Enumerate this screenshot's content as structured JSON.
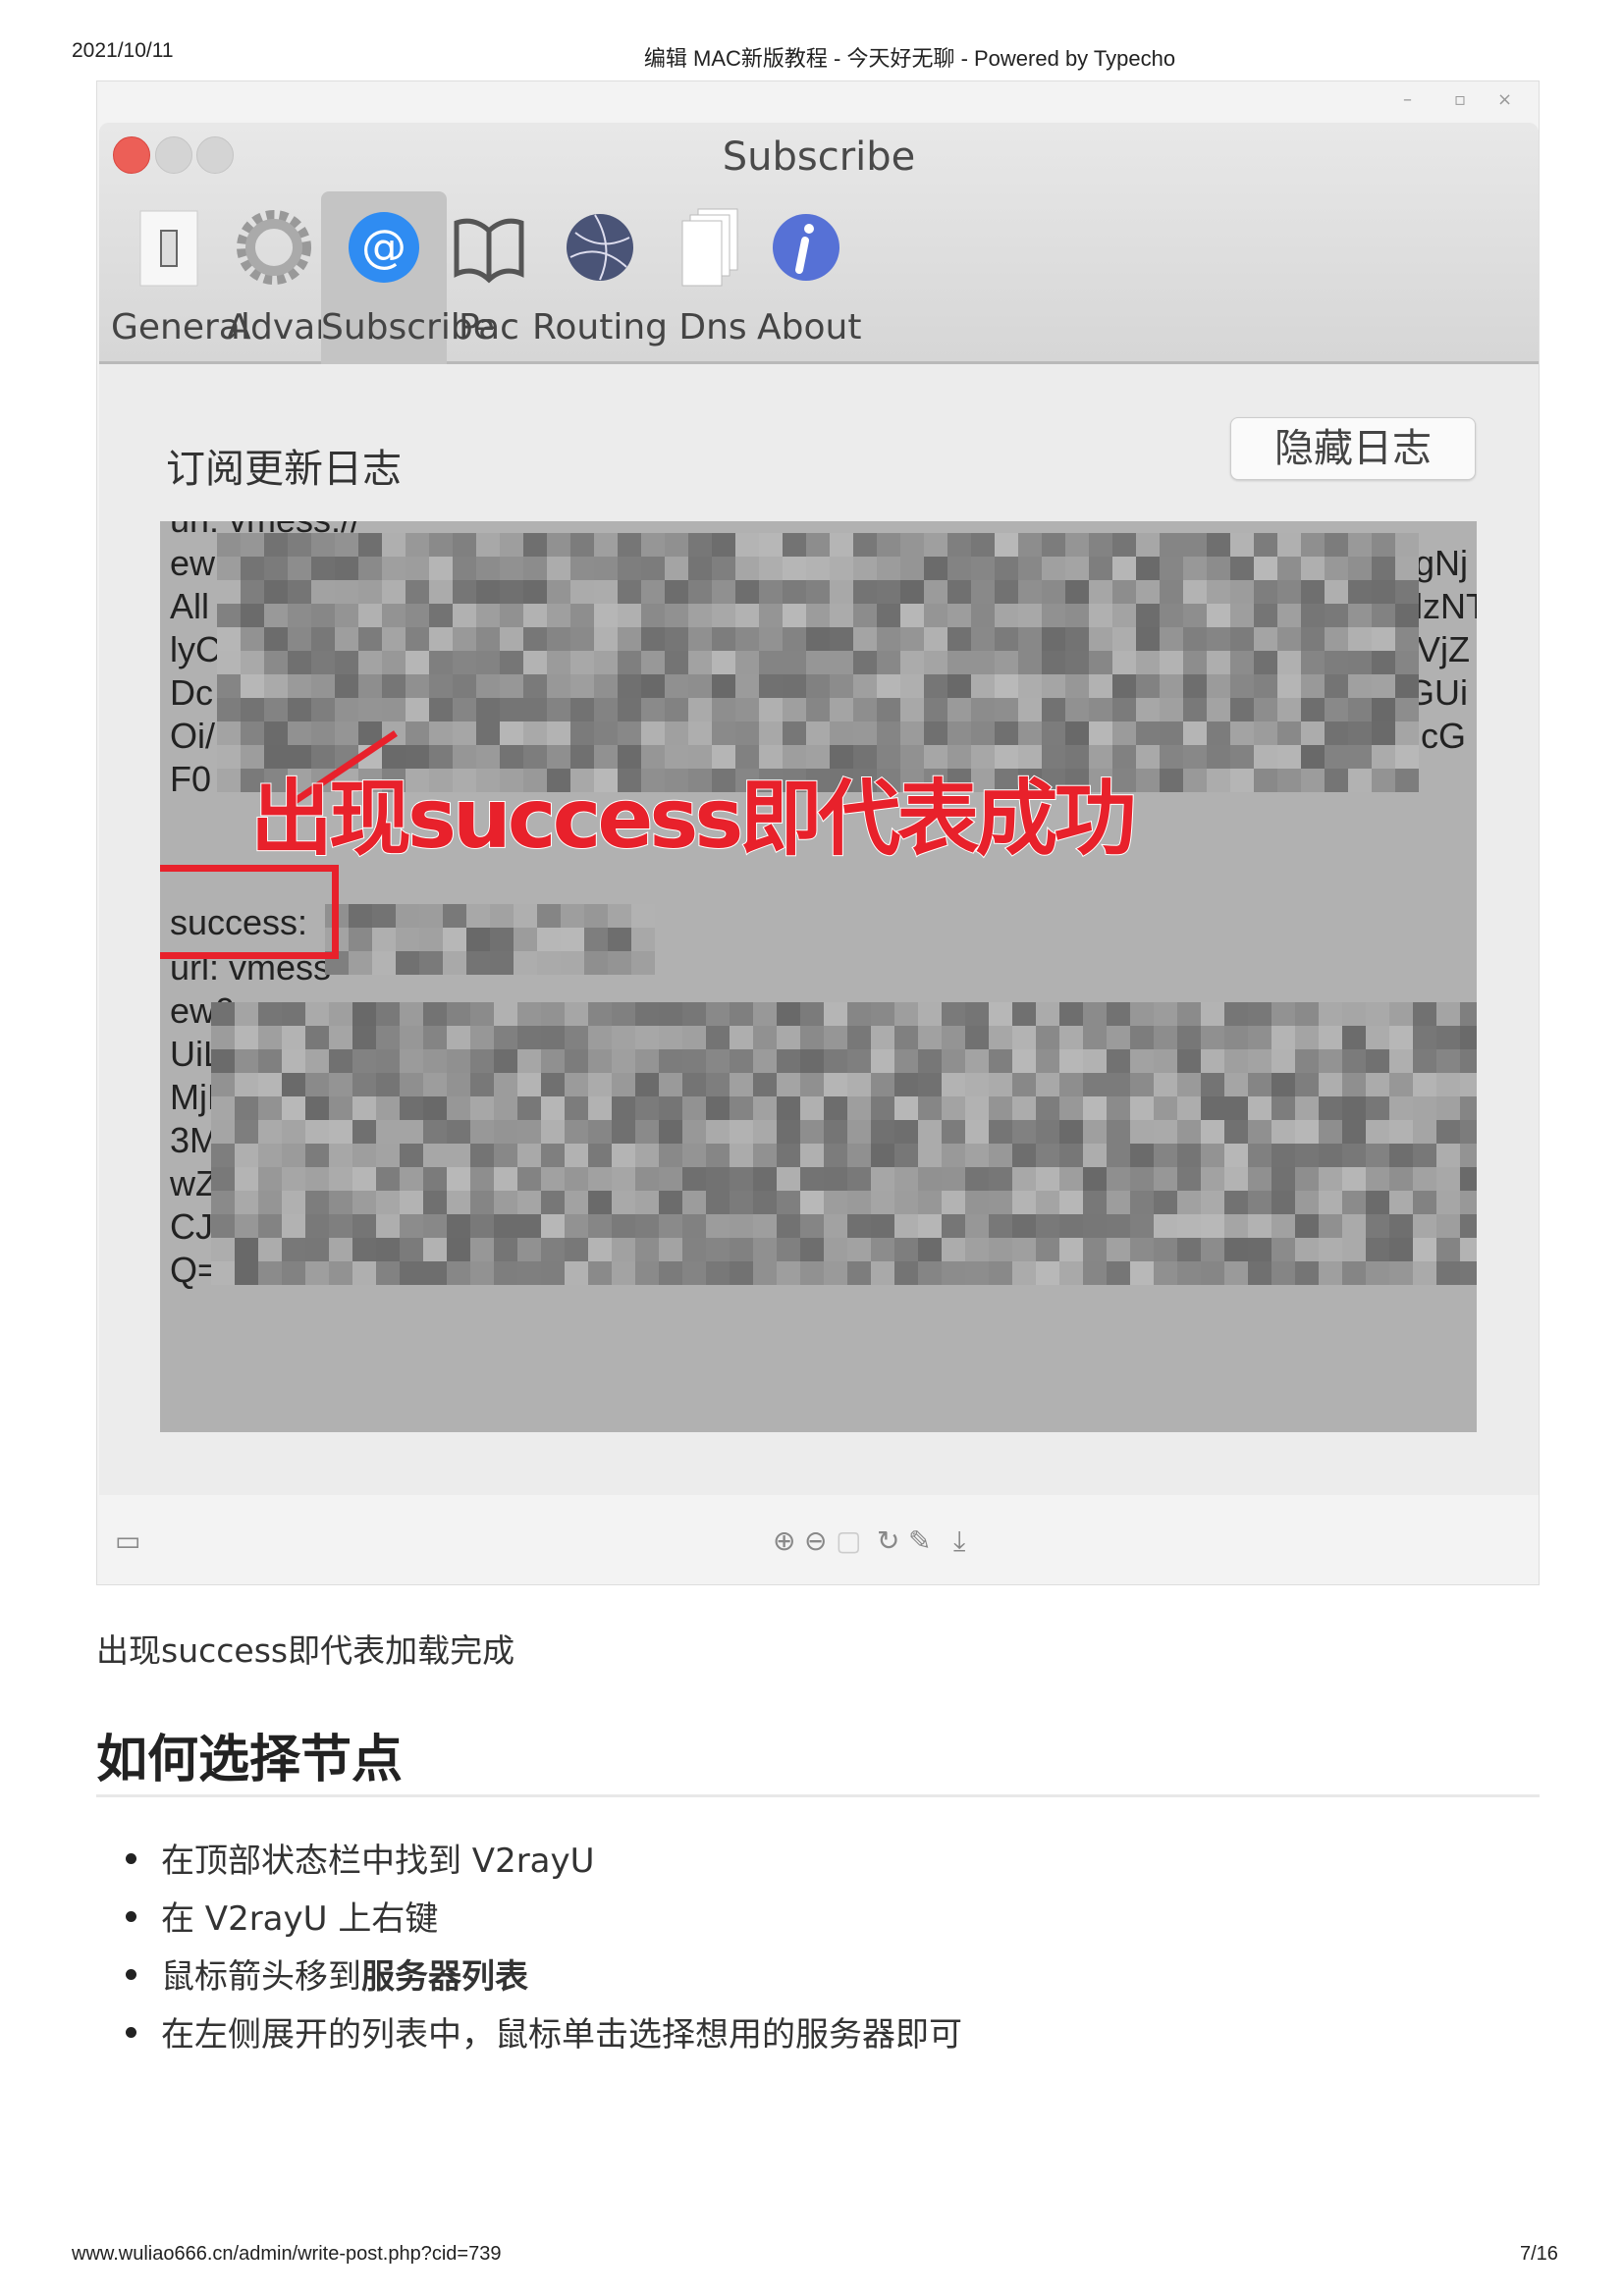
{
  "header": {
    "date": "2021/10/11",
    "title": "编辑 MAC新版教程 - 今天好无聊 - Powered by Typecho"
  },
  "window": {
    "controls": {
      "minimize": "–",
      "restore": "▫",
      "close": "×"
    },
    "title": "Subscribe",
    "tabs": [
      {
        "label": "General",
        "icon": "toggle-switch-icon"
      },
      {
        "label": "Advance",
        "icon": "gear-icon"
      },
      {
        "label": "Subscribe",
        "icon": "at-sign-icon",
        "selected": true
      },
      {
        "label": "Pac",
        "icon": "book-icon"
      },
      {
        "label": "Routing",
        "icon": "globe-network-icon"
      },
      {
        "label": "Dns",
        "icon": "documents-icon"
      },
      {
        "label": "About",
        "icon": "info-icon"
      }
    ],
    "log_label": "订阅更新日志",
    "hide_log_button": "隐藏日志",
    "log_lines_left": [
      "url: vmess://",
      "ew",
      "All",
      "lyC",
      "Dc",
      "Oi/",
      "F0",
      "success:",
      "url: vmess",
      "ew0",
      "UiL",
      "MjN",
      "3M",
      "wZ",
      "CJ\\",
      "Q=="
    ],
    "log_lines_right": [
      "wgNj",
      "ClzNT",
      "GVjZ",
      "cGUi",
      "AicG",
      "="
    ],
    "annotation": "出现success即代表成功",
    "annotation_color": "#e8212b"
  },
  "viewer_toolbar": {
    "icons": [
      "thumbnail-icon",
      "zoom-in-icon",
      "zoom-out-icon",
      "actual-size-icon",
      "rotate-icon",
      "edit-icon",
      "download-icon"
    ]
  },
  "article": {
    "caption": "出现success即代表加载完成",
    "heading": "如何选择节点",
    "bullets": [
      {
        "text": "在顶部状态栏中找到 V2rayU"
      },
      {
        "text": "在 V2rayU 上右键"
      },
      {
        "text": "鼠标箭头移到",
        "bold": "服务器列表"
      },
      {
        "text": "在左侧展开的列表中，鼠标单击选择想用的服务器即可"
      }
    ]
  },
  "footer": {
    "url": "www.wuliao666.cn/admin/write-post.php?cid=739",
    "page": "7/16"
  }
}
